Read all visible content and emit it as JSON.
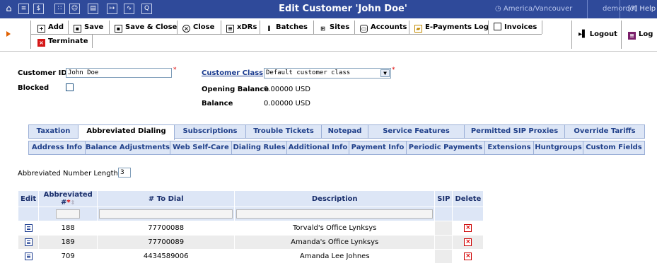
{
  "topbar": {
    "icons": [
      "home-icon",
      "list-icon",
      "dollar-icon",
      "grid-icon",
      "person-icon",
      "account-icon",
      "transfer-icon",
      "chart-icon",
      "search-icon"
    ],
    "title": "Edit Customer 'John Doe'",
    "timezone": "America/Vancouver",
    "user": "demoroot",
    "help": "Help"
  },
  "toolbar": {
    "add": "Add",
    "save": "Save",
    "save_close": "Save & Close",
    "close": "Close",
    "xdrs": "xDRs",
    "batches": "Batches",
    "sites": "Sites",
    "accounts": "Accounts",
    "epayments": "E-Payments Log",
    "invoices": "Invoices",
    "terminate": "Terminate",
    "logout": "Logout",
    "log": "Log"
  },
  "form": {
    "customer_id_label": "Customer ID",
    "customer_id_value": "John Doe",
    "blocked_label": "Blocked",
    "customer_class_label": "Customer Class",
    "customer_class_value": "Default customer class",
    "opening_balance_label": "Opening Balance",
    "opening_balance_value": "0.00000 USD",
    "balance_label": "Balance",
    "balance_value": "0.00000 USD"
  },
  "tabs_row1": [
    "Taxation",
    "Abbreviated Dialing",
    "Subscriptions",
    "Trouble Tickets",
    "Notepad",
    "Service Features",
    "Permitted SIP Proxies",
    "Override Tariffs"
  ],
  "tabs_row2": [
    "Address Info",
    "Balance Adjustments",
    "Web Self-Care",
    "Dialing Rules",
    "Additional Info",
    "Payment Info",
    "Periodic Payments",
    "Extensions",
    "Huntgroups",
    "Custom Fields"
  ],
  "abbr_length_label": "Abbreviated Number Length",
  "abbr_length_value": "3",
  "table": {
    "headers": {
      "edit": "Edit",
      "abbr": "Abbreviated #",
      "todial": "# To Dial",
      "desc": "Description",
      "sip": "SIP",
      "del": "Delete"
    },
    "rows": [
      {
        "abbr": "188",
        "todial": "77700088",
        "desc": "Torvald's Office Lynksys"
      },
      {
        "abbr": "189",
        "todial": "77700089",
        "desc": "Amanda's Office Lynksys"
      },
      {
        "abbr": "709",
        "todial": "4434589006",
        "desc": "Amanda Lee Johnes"
      }
    ]
  }
}
